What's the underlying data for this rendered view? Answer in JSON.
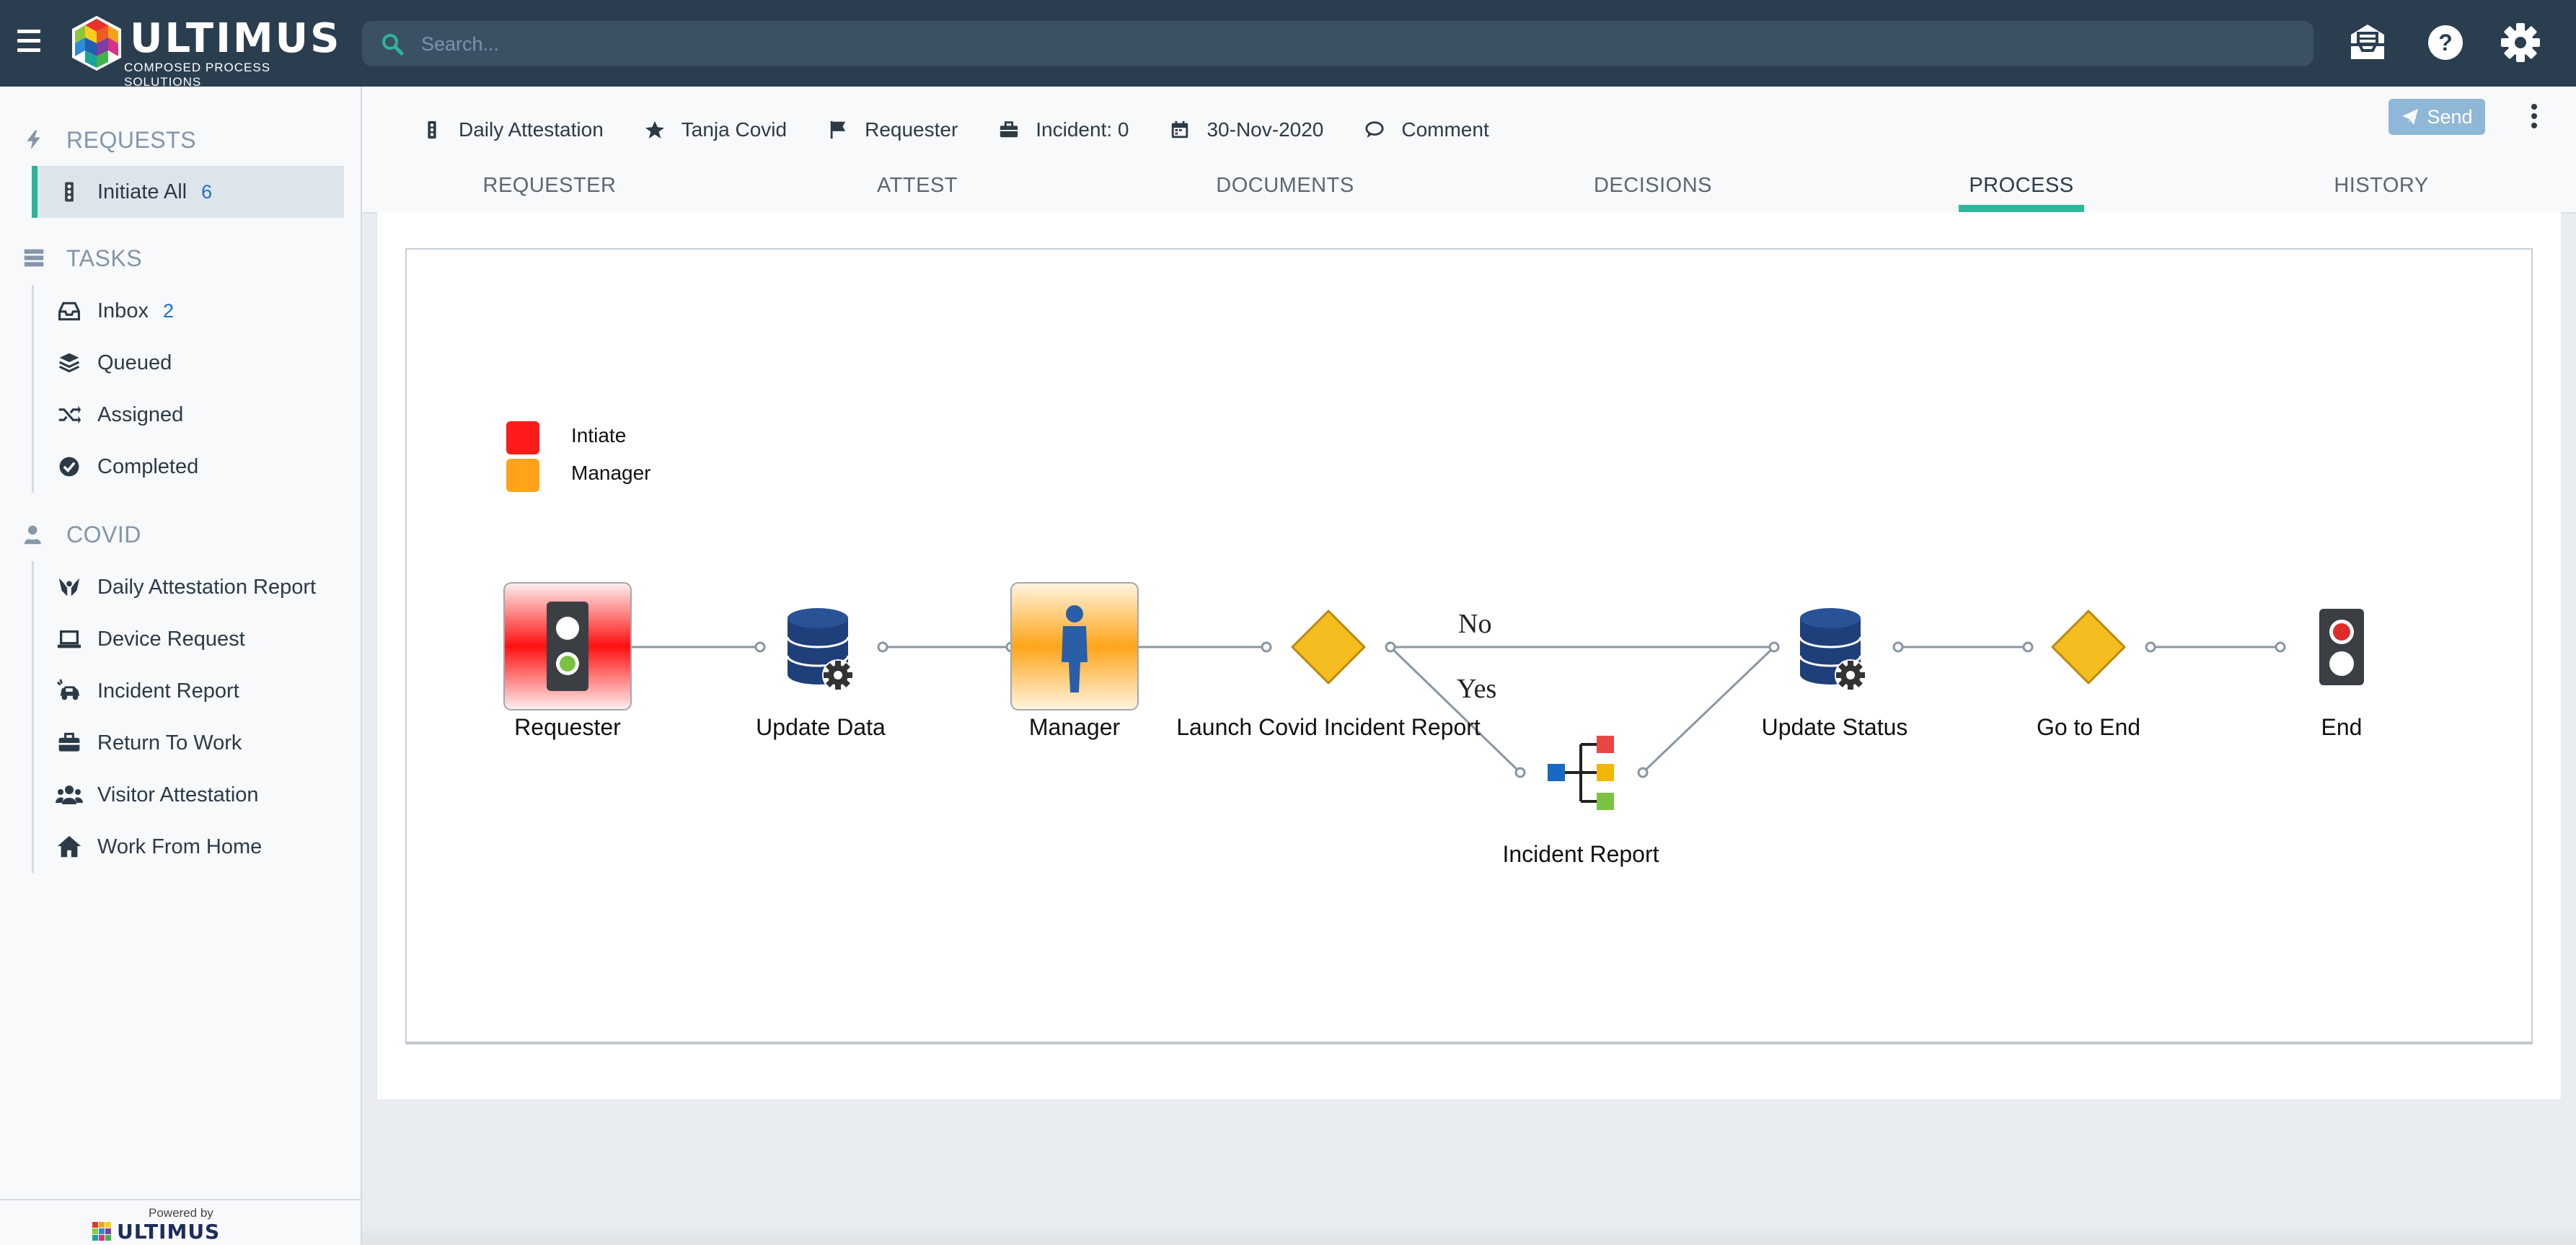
{
  "app": {
    "logo_text": "ULTIMUS",
    "logo_subtitle": "COMPOSED PROCESS SOLUTIONS",
    "search_placeholder": "Search..."
  },
  "topbar_icons": [
    "hamburger-icon",
    "mail-tray-icon",
    "help-icon",
    "gear-icon"
  ],
  "sidebar": {
    "sections": [
      {
        "title": "REQUESTS",
        "icon": "bolt-icon",
        "items": [
          {
            "label": "Initiate All",
            "count": "6",
            "icon": "traffic-light-icon",
            "active": true
          }
        ]
      },
      {
        "title": "TASKS",
        "icon": "server-icon",
        "items": [
          {
            "label": "Inbox",
            "count": "2",
            "icon": "inbox-icon"
          },
          {
            "label": "Queued",
            "icon": "layers-icon"
          },
          {
            "label": "Assigned",
            "icon": "shuffle-icon"
          },
          {
            "label": "Completed",
            "icon": "check-circle-icon"
          }
        ]
      },
      {
        "title": "COVID",
        "icon": "user-shield-icon",
        "items": [
          {
            "label": "Daily Attestation Report",
            "icon": "hands-icon"
          },
          {
            "label": "Device Request",
            "icon": "laptop-icon"
          },
          {
            "label": "Incident Report",
            "icon": "car-crash-icon"
          },
          {
            "label": "Return To Work",
            "icon": "briefcase-icon"
          },
          {
            "label": "Visitor Attestation",
            "icon": "users-icon"
          },
          {
            "label": "Work From Home",
            "icon": "home-icon"
          }
        ]
      }
    ],
    "powered_by": "Powered by",
    "powered_logo": "ULTIMUS"
  },
  "header": {
    "meta": [
      {
        "icon": "traffic-light-icon",
        "text": "Daily Attestation"
      },
      {
        "icon": "star-icon",
        "text": "Tanja Covid"
      },
      {
        "icon": "flag-icon",
        "text": "Requester"
      },
      {
        "icon": "briefcase-icon",
        "text": "Incident: 0"
      },
      {
        "icon": "calendar-icon",
        "text": "30-Nov-2020"
      },
      {
        "icon": "comment-icon",
        "text": "Comment"
      }
    ],
    "send_label": "Send",
    "tabs": [
      "REQUESTER",
      "ATTEST",
      "DOCUMENTS",
      "DECISIONS",
      "PROCESS",
      "HISTORY"
    ],
    "active_tab": "PROCESS"
  },
  "process": {
    "legend": [
      {
        "label": "Intiate",
        "color": "#ff1a1a"
      },
      {
        "label": "Manager",
        "color": "#ffa31a"
      }
    ],
    "nodes": [
      {
        "label": "Requester",
        "type": "start-task"
      },
      {
        "label": "Update Data",
        "type": "database-step"
      },
      {
        "label": "Manager",
        "type": "user-task"
      },
      {
        "label": "Launch Covid Incident Report",
        "type": "decision"
      },
      {
        "label": "Incident Report",
        "type": "subprocess"
      },
      {
        "label": "Update Status",
        "type": "database-step"
      },
      {
        "label": "Go to End",
        "type": "decision"
      },
      {
        "label": "End",
        "type": "end"
      }
    ],
    "edge_labels": [
      "No",
      "Yes"
    ]
  },
  "colors": {
    "topbar": "#2b3e50",
    "accent": "#2fb59a",
    "link": "#1e6fbf",
    "send_button": "#8fb7d6",
    "decision": "#f5bd1f",
    "database": "#1f3f7a"
  }
}
